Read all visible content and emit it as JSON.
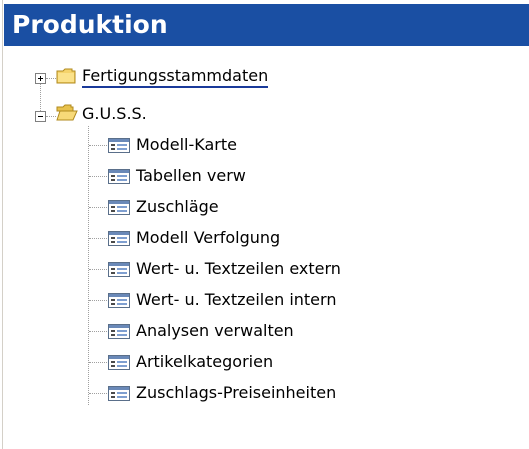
{
  "header": {
    "title": "Produktion"
  },
  "tree": {
    "nodes": [
      {
        "label": "Fertigungsstammdaten",
        "state": "collapsed",
        "icon": "folder-closed-icon"
      },
      {
        "label": "G.U.S.S.",
        "state": "expanded",
        "icon": "folder-open-icon"
      }
    ],
    "guss_children": [
      {
        "label": "Modell-Karte",
        "icon": "form-icon"
      },
      {
        "label": "Tabellen verw",
        "icon": "form-icon"
      },
      {
        "label": "Zuschläge",
        "icon": "form-icon"
      },
      {
        "label": "Modell Verfolgung",
        "icon": "form-icon"
      },
      {
        "label": "Wert- u. Textzeilen extern",
        "icon": "form-icon"
      },
      {
        "label": "Wert- u. Textzeilen intern",
        "icon": "form-icon"
      },
      {
        "label": "Analysen verwalten",
        "icon": "form-icon"
      },
      {
        "label": "Artikelkategorien",
        "icon": "form-icon"
      },
      {
        "label": "Zuschlags-Preiseinheiten",
        "icon": "form-icon"
      }
    ]
  },
  "colors": {
    "header_bg": "#1a4fa3",
    "header_text": "#ffffff",
    "folder_fill": "#f5d36b",
    "folder_stroke": "#b08a1e",
    "selection_underline": "#1a3a9a"
  }
}
